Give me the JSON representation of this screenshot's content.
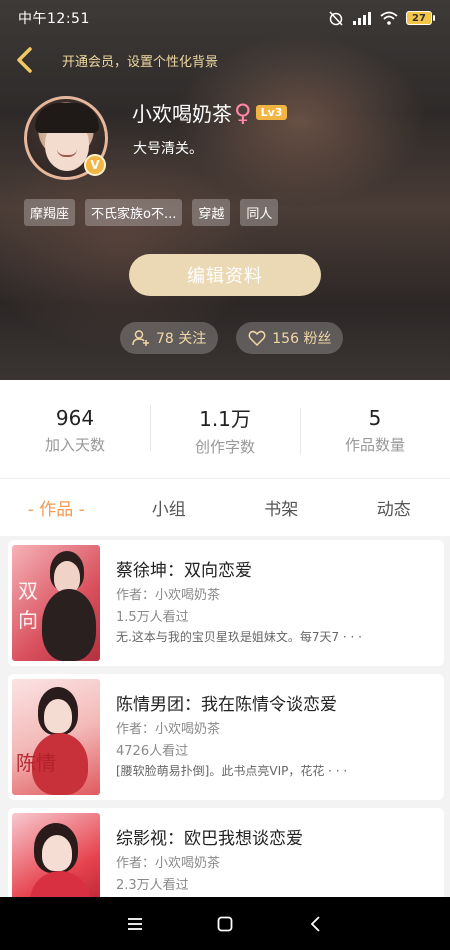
{
  "status_bar": {
    "time": "中午12:51",
    "battery": "27"
  },
  "header": {
    "vip_hint": "开通会员，设置个性化背景",
    "username": "小欢喝奶茶",
    "gender_symbol": "♀",
    "level": "Lv3",
    "vip_badge": "V",
    "signature": "大号清关。",
    "tags": [
      "摩羯座",
      "不氏家族o不...",
      "穿越",
      "同人"
    ],
    "edit_button": "编辑资料",
    "following": "78 关注",
    "followers": "156 粉丝"
  },
  "stats": [
    {
      "value": "964",
      "label": "加入天数"
    },
    {
      "value": "1.1万",
      "label": "创作字数"
    },
    {
      "value": "5",
      "label": "作品数量"
    }
  ],
  "tabs": [
    "- 作品 -",
    "小组",
    "书架",
    "动态"
  ],
  "books": [
    {
      "title": "蔡徐坤：双向恋爱",
      "author": "作者：小欢喝奶茶",
      "views": "1.5万人看过",
      "desc": "无.这本与我的宝贝星玖是姐妹文。每7天7 · · ·"
    },
    {
      "title": "陈情男团：我在陈情令谈恋爱",
      "author": "作者：小欢喝奶茶",
      "views": "4726人看过",
      "desc": "[腰软脸萌易扑倒]。此书点亮VIP，花花 · · ·"
    },
    {
      "title": "综影视：欧巴我想谈恋爱",
      "author": "作者：小欢喝奶茶",
      "views": "2.3万人看过",
      "desc": ""
    }
  ],
  "colors": {
    "accent": "#f29a50",
    "gold": "#f2b544",
    "pill_text": "#f2d7a6"
  }
}
